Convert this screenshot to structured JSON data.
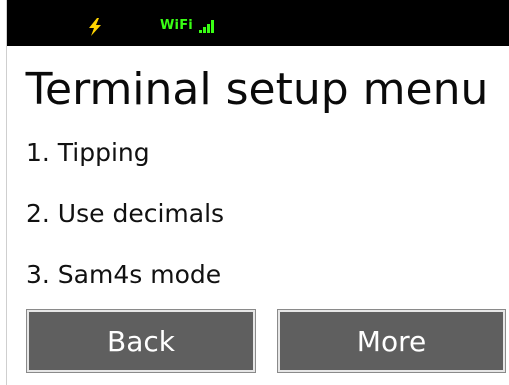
{
  "status_bar": {
    "power_icon": "lightning-bolt-icon",
    "wifi_label": "WiFi",
    "signal_icon": "signal-bars-icon",
    "colors": {
      "background": "#000000",
      "bolt": "#ffd400",
      "wifi": "#39ff14"
    }
  },
  "screen": {
    "title": "Terminal setup menu"
  },
  "menu": {
    "items": [
      {
        "label": "1. Tipping"
      },
      {
        "label": "2. Use decimals"
      },
      {
        "label": "3. Sam4s mode"
      }
    ]
  },
  "buttons": {
    "back_label": "Back",
    "more_label": "More",
    "background_color": "#5f5f5f"
  }
}
